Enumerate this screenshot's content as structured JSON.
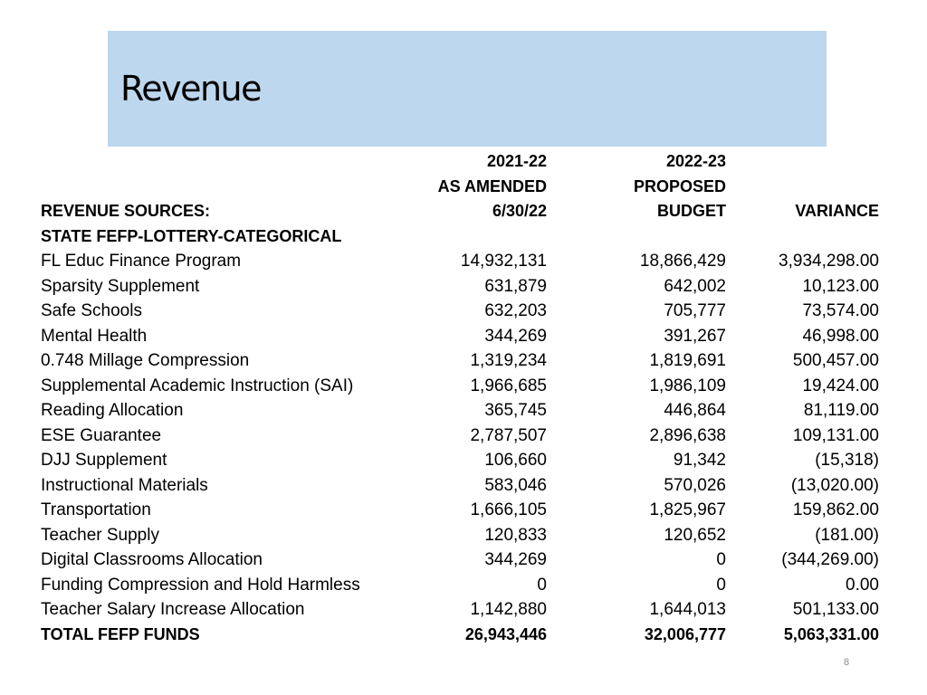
{
  "slide": {
    "title": "Revenue",
    "page_number": "8"
  },
  "header": {
    "line1": {
      "col_a": "2021-22",
      "col_b": "2022-23"
    },
    "line2": {
      "col_a": "AS AMENDED",
      "col_b": "PROPOSED"
    },
    "line3": {
      "label": "REVENUE SOURCES:",
      "col_a": "6/30/22",
      "col_b": "BUDGET",
      "col_v": "VARIANCE"
    },
    "section": "STATE FEFP-LOTTERY-CATEGORICAL"
  },
  "rows": [
    {
      "label": "FL Educ Finance Program",
      "a": "14,932,131",
      "b": "18,866,429",
      "v": "3,934,298.00"
    },
    {
      "label": "Sparsity Supplement",
      "a": "631,879",
      "b": "642,002",
      "v": "10,123.00"
    },
    {
      "label": "Safe Schools",
      "a": "632,203",
      "b": "705,777",
      "v": "73,574.00"
    },
    {
      "label": "Mental Health",
      "a": "344,269",
      "b": "391,267",
      "v": "46,998.00"
    },
    {
      "label": "0.748 Millage Compression",
      "a": "1,319,234",
      "b": "1,819,691",
      "v": "500,457.00"
    },
    {
      "label": "Supplemental Academic Instruction (SAI)",
      "a": "1,966,685",
      "b": "1,986,109",
      "v": "19,424.00"
    },
    {
      "label": "Reading Allocation",
      "a": "365,745",
      "b": "446,864",
      "v": "81,119.00"
    },
    {
      "label": "ESE Guarantee",
      "a": "2,787,507",
      "b": "2,896,638",
      "v": "109,131.00"
    },
    {
      "label": "DJJ Supplement",
      "a": "106,660",
      "b": "91,342",
      "v": "(15,318)"
    },
    {
      "label": "Instructional Materials",
      "a": "583,046",
      "b": "570,026",
      "v": "(13,020.00)"
    },
    {
      "label": "Transportation",
      "a": "1,666,105",
      "b": "1,825,967",
      "v": "159,862.00"
    },
    {
      "label": "Teacher Supply",
      "a": "120,833",
      "b": "120,652",
      "v": "(181.00)"
    },
    {
      "label": "Digital Classrooms Allocation",
      "a": "344,269",
      "b": "0",
      "v": "(344,269.00)"
    },
    {
      "label": "Funding Compression and Hold Harmless",
      "a": "0",
      "b": "0",
      "v": "0.00"
    },
    {
      "label": "Teacher Salary Increase Allocation",
      "a": "1,142,880",
      "b": "1,644,013",
      "v": "501,133.00"
    }
  ],
  "total": {
    "label": "TOTAL FEFP FUNDS",
    "a": "26,943,446",
    "b": "32,006,777",
    "v": "5,063,331.00"
  }
}
